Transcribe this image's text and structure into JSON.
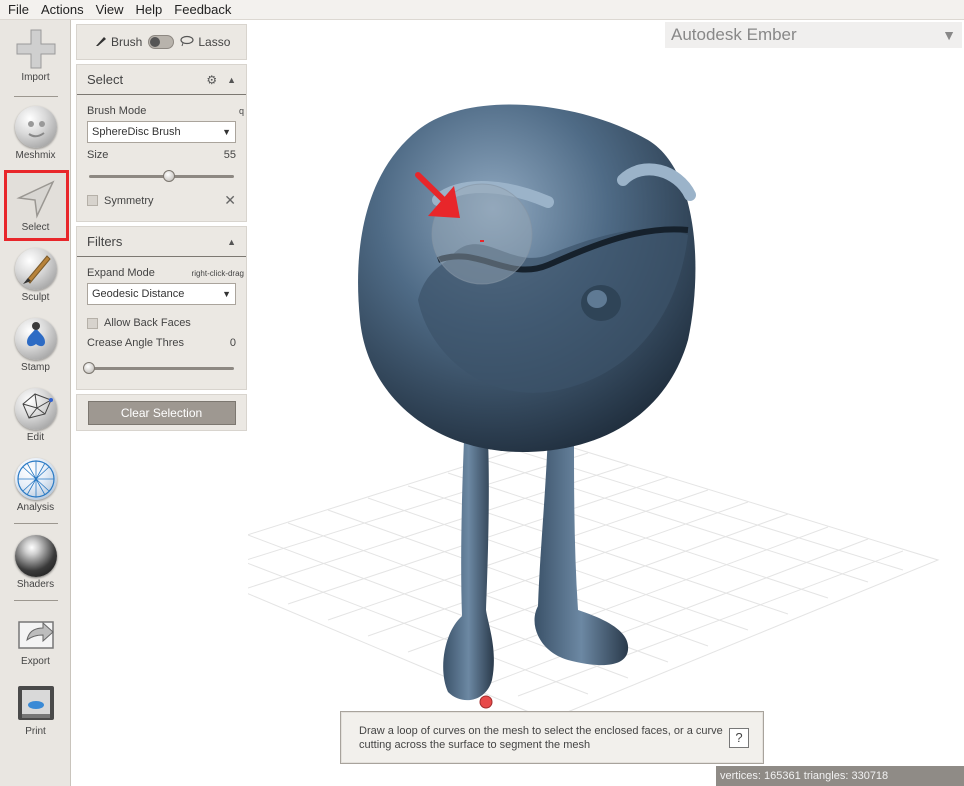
{
  "menu": [
    "File",
    "Actions",
    "View",
    "Help",
    "Feedback"
  ],
  "tools": [
    {
      "label": "Import"
    },
    {
      "label": "Meshmix"
    },
    {
      "label": "Select"
    },
    {
      "label": "Sculpt"
    },
    {
      "label": "Stamp"
    },
    {
      "label": "Edit"
    },
    {
      "label": "Analysis"
    },
    {
      "label": "Shaders"
    },
    {
      "label": "Export"
    },
    {
      "label": "Print"
    }
  ],
  "mode_toggle": {
    "brush": "Brush",
    "lasso": "Lasso"
  },
  "select_panel": {
    "title": "Select",
    "brush_mode_label": "Brush Mode",
    "brush_mode_hotkey": "q",
    "brush_mode_value": "SphereDisc Brush",
    "size_label": "Size",
    "size_value": "55",
    "size_fraction": 0.55,
    "symmetry_label": "Symmetry"
  },
  "filters_panel": {
    "title": "Filters",
    "expand_mode_label": "Expand Mode",
    "expand_mode_hint": "right-click-drag",
    "expand_mode_value": "Geodesic Distance",
    "allow_back_faces_label": "Allow Back Faces",
    "crease_label": "Crease Angle Thres",
    "crease_value": "0",
    "crease_fraction": 0.0
  },
  "clear_selection_label": "Clear Selection",
  "ember_label": "Autodesk Ember",
  "tooltip_text_line1": "Draw a loop of curves on the mesh to select the enclosed faces, or a curve",
  "tooltip_text_line2": "cutting across the surface to segment the mesh",
  "help_label": "?",
  "status": "vertices: 165361 triangles: 330718",
  "colors": {
    "mesh": "#4f6b86",
    "highlight": "#e8262a",
    "button": "#9e9891"
  }
}
